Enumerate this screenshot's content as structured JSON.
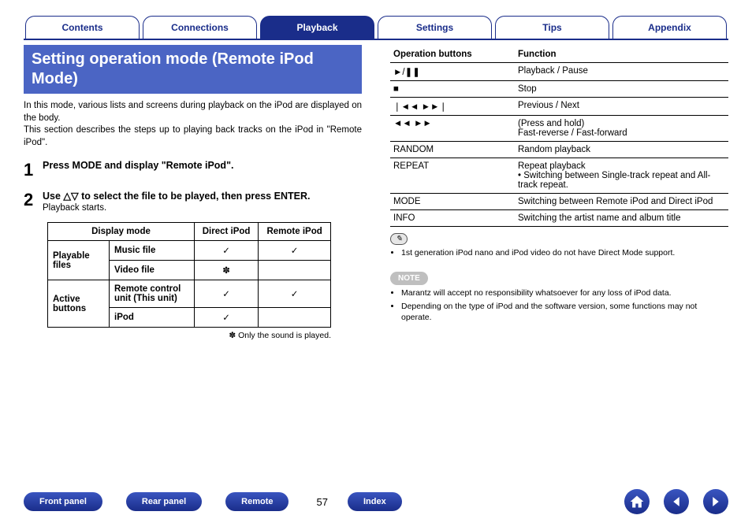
{
  "tabs": [
    "Contents",
    "Connections",
    "Playback",
    "Settings",
    "Tips",
    "Appendix"
  ],
  "tabs_active_index": 2,
  "heading": "Setting operation mode (Remote iPod Mode)",
  "intro": [
    "In this mode, various lists and screens during playback on the iPod are displayed on the body.",
    "This section describes the steps up to playing back tracks on the iPod in \"Remote iPod\"."
  ],
  "steps": [
    {
      "num": "1",
      "title": "Press MODE and display \"Remote iPod\".",
      "sub": ""
    },
    {
      "num": "2",
      "title": "Use △▽ to select the file to be played, then press ENTER.",
      "sub": "Playback starts."
    }
  ],
  "mode_table": {
    "headers": [
      "Display mode",
      "Direct iPod",
      "Remote iPod"
    ],
    "groups": [
      {
        "label": "Playable files",
        "rows": [
          {
            "t": "Music file",
            "d": "✓",
            "r": "✓"
          },
          {
            "t": "Video file",
            "d": "✽",
            "r": ""
          }
        ]
      },
      {
        "label": "Active buttons",
        "rows": [
          {
            "t": "Remote control unit (This unit)",
            "d": "✓",
            "r": "✓"
          },
          {
            "t": "iPod",
            "d": "✓",
            "r": ""
          }
        ]
      }
    ],
    "note": "✽ Only the sound is played."
  },
  "ops_table": {
    "headers": [
      "Operation buttons",
      "Function"
    ],
    "rows": [
      {
        "b": "►/❚❚",
        "f": "Playback / Pause"
      },
      {
        "b": "■",
        "f": "Stop"
      },
      {
        "b": "❘◄◄ ►►❘",
        "f": "Previous / Next"
      },
      {
        "b": "◄◄ ►►",
        "f": "(Press and hold)\nFast-reverse / Fast-forward"
      },
      {
        "b": "RANDOM",
        "f": "Random playback"
      },
      {
        "b": "REPEAT",
        "f": "Repeat playback\n• Switching between Single-track repeat and All-track repeat."
      },
      {
        "b": "MODE",
        "f": "Switching between Remote iPod and Direct iPod"
      },
      {
        "b": "INFO",
        "f": "Switching the artist name and album title"
      }
    ]
  },
  "pencil_notes": [
    "1st generation iPod nano and iPod video do not have Direct Mode support."
  ],
  "note_label": "NOTE",
  "note_items": [
    "Marantz will accept no responsibility whatsoever for any loss of iPod data.",
    "Depending on the type of iPod and the software version, some functions may not operate."
  ],
  "footer": {
    "buttons": [
      "Front panel",
      "Rear panel",
      "Remote"
    ],
    "page_number": "57",
    "index_button": "Index"
  }
}
